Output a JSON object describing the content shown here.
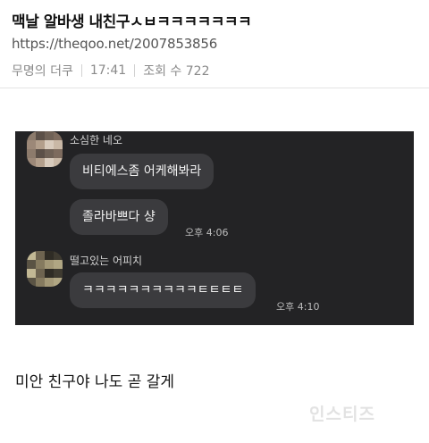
{
  "post": {
    "title": "맥날 알바생 내친구ㅅㅂㅋㅋㅋㅋㅋㅋㅋ",
    "url": "https://theqoo.net/2007853856",
    "author": "무명의 더쿠",
    "time": "17:41",
    "views_label": "조회 수 722"
  },
  "chat": {
    "messages": [
      {
        "sender": "소심한 네오",
        "bubbles": [
          "비티에스좀 어케해봐라",
          "졸라바쁘다 샹"
        ],
        "time": "오후 4:06"
      },
      {
        "sender": "떨고있는 어피치",
        "bubbles": [
          "ㅋㅋㅋㅋㅋㅋㅋㅋㅋㅋㅌㅌㅌㅌ"
        ],
        "time": "오후 4:10"
      }
    ]
  },
  "caption": "미안 친구야 나도 곧 갈게",
  "watermark": "인스티즈",
  "colors": {
    "chat_background": "#232325",
    "bubble": "#3b3b3e",
    "bubble_text": "#f2f2f2",
    "meta_text": "#8a8a8a"
  }
}
